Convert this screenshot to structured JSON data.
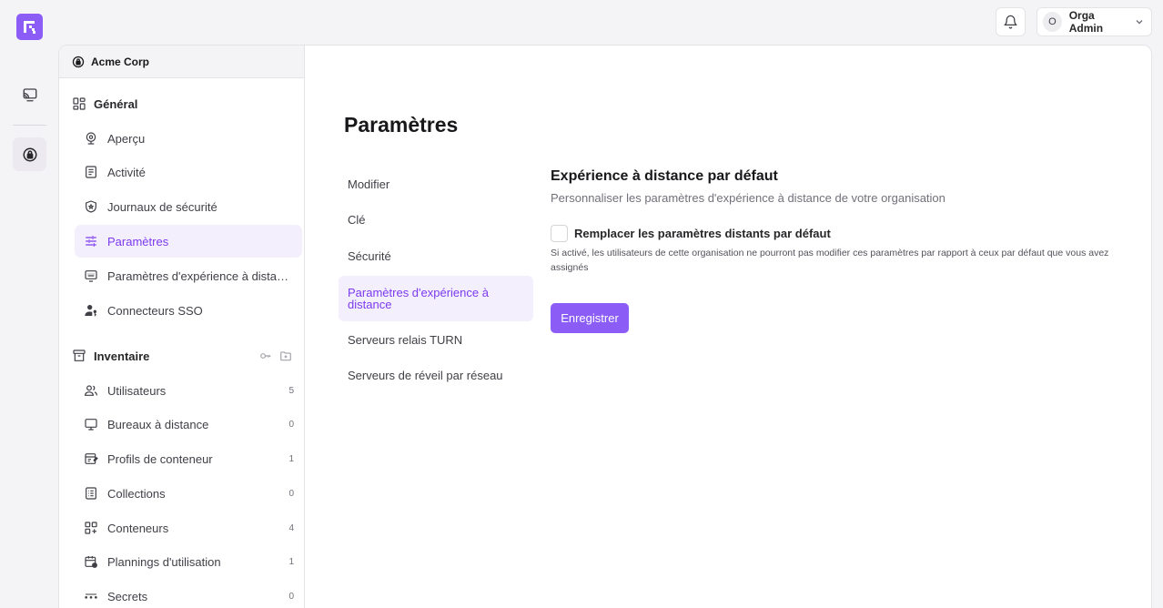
{
  "user": {
    "initial": "O",
    "name": "Orga Admin"
  },
  "org": {
    "name": "Acme Corp"
  },
  "sections": {
    "general": "Général",
    "inventory": "Inventaire"
  },
  "general_items": [
    {
      "label": "Aperçu",
      "icon": "camera-badge-icon"
    },
    {
      "label": "Activité",
      "icon": "document-list-icon"
    },
    {
      "label": "Journaux de sécurité",
      "icon": "shield-icon"
    },
    {
      "label": "Paramètres",
      "icon": "sliders-icon"
    },
    {
      "label": "Paramètres d'expérience à distance",
      "icon": "remote-screen-icon"
    },
    {
      "label": "Connecteurs SSO",
      "icon": "user-key-icon"
    }
  ],
  "inventory_items": [
    {
      "label": "Utilisateurs",
      "count": "5",
      "icon": "users-icon"
    },
    {
      "label": "Bureaux à distance",
      "count": "0",
      "icon": "monitor-icon"
    },
    {
      "label": "Profils de conteneur",
      "count": "1",
      "icon": "container-profile-icon"
    },
    {
      "label": "Collections",
      "count": "0",
      "icon": "collection-icon"
    },
    {
      "label": "Conteneurs",
      "count": "4",
      "icon": "grid-plus-icon"
    },
    {
      "label": "Plannings d'utilisation",
      "count": "1",
      "icon": "calendar-icon"
    },
    {
      "label": "Secrets",
      "count": "0",
      "icon": "dots-icon"
    }
  ],
  "page": {
    "title": "Paramètres"
  },
  "sub_nav": [
    "Modifier",
    "Clé",
    "Sécurité",
    "Paramètres d'expérience à distance",
    "Serveurs relais TURN",
    "Serveurs de réveil par réseau"
  ],
  "panel": {
    "title": "Expérience à distance par défaut",
    "description": "Personnaliser les paramètres d'expérience à distance de votre organisation",
    "checkbox_label": "Remplacer les paramètres distants par défaut",
    "checkbox_checked": false,
    "help": "Si activé, les utilisateurs de cette organisation ne pourront pas modifier ces paramètres par rapport à ceux par défaut que vous avez assignés",
    "save_label": "Enregistrer"
  },
  "colors": {
    "accent": "#8b5cf6",
    "accent_text": "#7c3aed",
    "active_bg": "#f3effd"
  }
}
